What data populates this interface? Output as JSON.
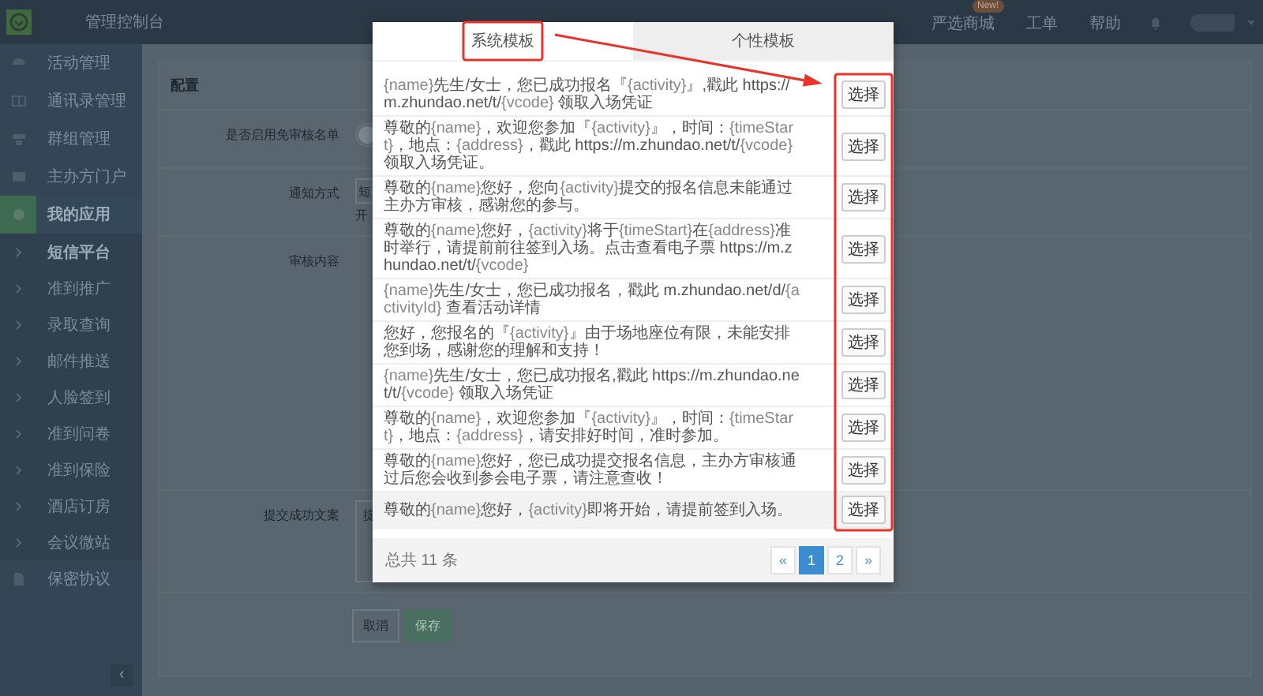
{
  "topbar": {
    "title": "管理控制台",
    "links": [
      {
        "label": "严选商城",
        "badge": "New!"
      },
      {
        "label": "工单"
      },
      {
        "label": "帮助"
      }
    ]
  },
  "sidebar": {
    "items": [
      {
        "label": "活动管理",
        "selected": false
      },
      {
        "label": "通讯录管理",
        "selected": false
      },
      {
        "label": "群组管理",
        "selected": false
      },
      {
        "label": "主办方门户",
        "selected": false
      },
      {
        "label": "我的应用",
        "selected": true,
        "children": [
          {
            "label": "短信平台",
            "selected": true
          },
          {
            "label": "准到推广",
            "selected": false
          },
          {
            "label": "录取查询",
            "selected": false
          },
          {
            "label": "邮件推送",
            "selected": false
          },
          {
            "label": "人脸签到",
            "selected": false
          },
          {
            "label": "准到问卷",
            "selected": false
          },
          {
            "label": "准到保险",
            "selected": false
          },
          {
            "label": "酒店订房",
            "selected": false
          },
          {
            "label": "会议微站",
            "selected": false
          }
        ]
      },
      {
        "label": "保密协议",
        "selected": false
      }
    ],
    "collapse_button": "‹"
  },
  "form": {
    "title": "配置",
    "fields": [
      {
        "label": "是否启用免审核名单",
        "kind": "toggle",
        "on": false
      },
      {
        "label": "通知方式",
        "kind": "select",
        "value": "短",
        "note": "开"
      },
      {
        "label": "审核内容",
        "kind": "blank"
      },
      {
        "label": "提交成功文案",
        "kind": "textarea",
        "value": "提"
      }
    ],
    "buttons": [
      {
        "label": "取消",
        "kind": "default"
      },
      {
        "label": "保存",
        "kind": "primary"
      }
    ]
  },
  "modal": {
    "tabs": [
      {
        "label": "系统模板",
        "selected": true
      },
      {
        "label": "个性模板",
        "selected": false
      }
    ],
    "templates": [
      {
        "text": "{name}先生/女士，您已成功报名『{activity}』,戳此 https://m.zhundao.net/t/{vcode} 领取入场凭证",
        "button": "选择",
        "hovered": false
      },
      {
        "text": "尊敬的{name}，欢迎您参加『{activity}』，时间：{timeStart}，地点：{address}，戳此 https://m.zhundao.net/t/{vcode} 领取入场凭证。",
        "button": "选择",
        "hovered": false
      },
      {
        "text": "尊敬的{name}您好，您向{activity}提交的报名信息未能通过主办方审核，感谢您的参与。",
        "button": "选择",
        "hovered": false
      },
      {
        "text": "尊敬的{name}您好，{activity}将于{timeStart}在{address}准时举行，请提前前往签到入场。点击查看电子票 https://m.zhundao.net/t/{vcode}",
        "button": "选择",
        "hovered": false
      },
      {
        "text": "{name}先生/女士，您已成功报名，戳此 m.zhundao.net/d/{activityId} 查看活动详情",
        "button": "选择",
        "hovered": false
      },
      {
        "text": "您好，您报名的『{activity}』由于场地座位有限，未能安排您到场，感谢您的理解和支持！",
        "button": "选择",
        "hovered": false
      },
      {
        "text": "{name}先生/女士，您已成功报名,戳此 https://m.zhundao.net/t/{vcode} 领取入场凭证",
        "button": "选择",
        "hovered": false
      },
      {
        "text": "尊敬的{name}，欢迎您参加『{activity}』，时间：{timeStart}，地点：{address}，请安排好时间，准时参加。",
        "button": "选择",
        "hovered": false
      },
      {
        "text": "尊敬的{name}您好，您已成功提交报名信息，主办方审核通过后您会收到参会电子票，请注意查收！",
        "button": "选择",
        "hovered": false
      },
      {
        "text": "尊敬的{name}您好，{activity}即将开始，请提前签到入场。",
        "button": "选择",
        "hovered": true
      }
    ],
    "total": "总共 11 条",
    "pagination": [
      {
        "label": "«",
        "selected": false
      },
      {
        "label": "1",
        "selected": true
      },
      {
        "label": "2",
        "selected": false
      },
      {
        "label": "»",
        "selected": false
      }
    ]
  },
  "annotations": [
    {
      "kind": "tab_box"
    },
    {
      "kind": "column_box"
    },
    {
      "kind": "arrow"
    }
  ]
}
